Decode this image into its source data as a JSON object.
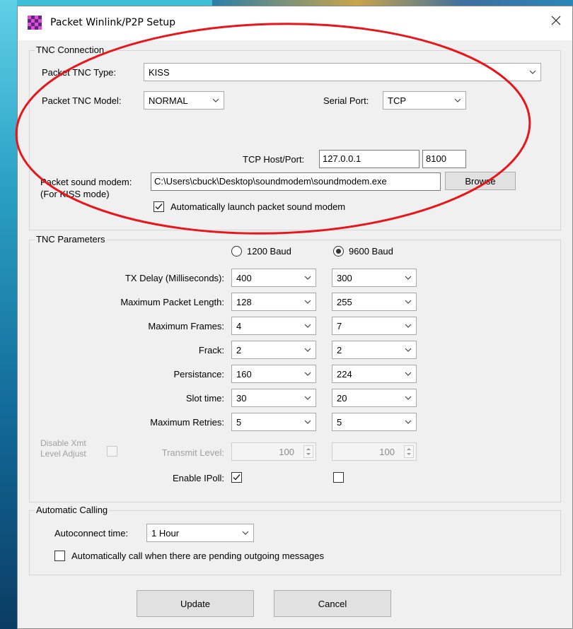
{
  "window": {
    "title": "Packet Winlink/P2P Setup"
  },
  "tnc_connection": {
    "group_label": "TNC Connection",
    "type_label": "Packet TNC Type:",
    "type_value": "KISS",
    "model_label": "Packet TNC Model:",
    "model_value": "NORMAL",
    "serial_label": "Serial Port:",
    "serial_value": "TCP",
    "host_label": "TCP Host/Port:",
    "host_value": "127.0.0.1",
    "port_value": "8100",
    "modem_label": "Packet sound modem:",
    "modem_sub_label": "(For KISS mode)",
    "modem_path": "C:\\Users\\cbuck\\Desktop\\soundmodem\\soundmodem.exe",
    "browse_label": "Browse",
    "auto_launch_label": "Automatically launch packet sound modem",
    "auto_launch_checked": true
  },
  "tnc_parameters": {
    "group_label": "TNC Parameters",
    "baud_1200_label": "1200 Baud",
    "baud_9600_label": "9600 Baud",
    "selected_baud": "9600",
    "rows": [
      {
        "label": "TX Delay (Milliseconds):",
        "v1200": "400",
        "v9600": "300"
      },
      {
        "label": "Maximum Packet Length:",
        "v1200": "128",
        "v9600": "255"
      },
      {
        "label": "Maximum Frames:",
        "v1200": "4",
        "v9600": "7"
      },
      {
        "label": "Frack:",
        "v1200": "2",
        "v9600": "2"
      },
      {
        "label": "Persistance:",
        "v1200": "160",
        "v9600": "224"
      },
      {
        "label": "Slot time:",
        "v1200": "30",
        "v9600": "20"
      },
      {
        "label": "Maximum Retries:",
        "v1200": "5",
        "v9600": "5"
      }
    ],
    "disable_xmt_label_1": "Disable Xmt",
    "disable_xmt_label_2": "Level Adjust",
    "transmit_level_label": "Transmit Level:",
    "transmit_level_1200": "100",
    "transmit_level_9600": "100",
    "ipoll_label": "Enable IPoll:",
    "ipoll_1200_checked": true,
    "ipoll_9600_checked": false
  },
  "auto_calling": {
    "group_label": "Automatic Calling",
    "autoconnect_label": "Autoconnect time:",
    "autoconnect_value": "1 Hour",
    "auto_call_label": "Automatically call when there are pending outgoing messages",
    "auto_call_checked": false
  },
  "buttons": {
    "update": "Update",
    "cancel": "Cancel"
  },
  "colors": {
    "annotation_ellipse": "#e8151b",
    "window_bg": "#f0f0f0"
  },
  "icons": {
    "app": "winlink-checker-icon",
    "close": "close-icon",
    "dropdown": "chevron-down-icon"
  }
}
